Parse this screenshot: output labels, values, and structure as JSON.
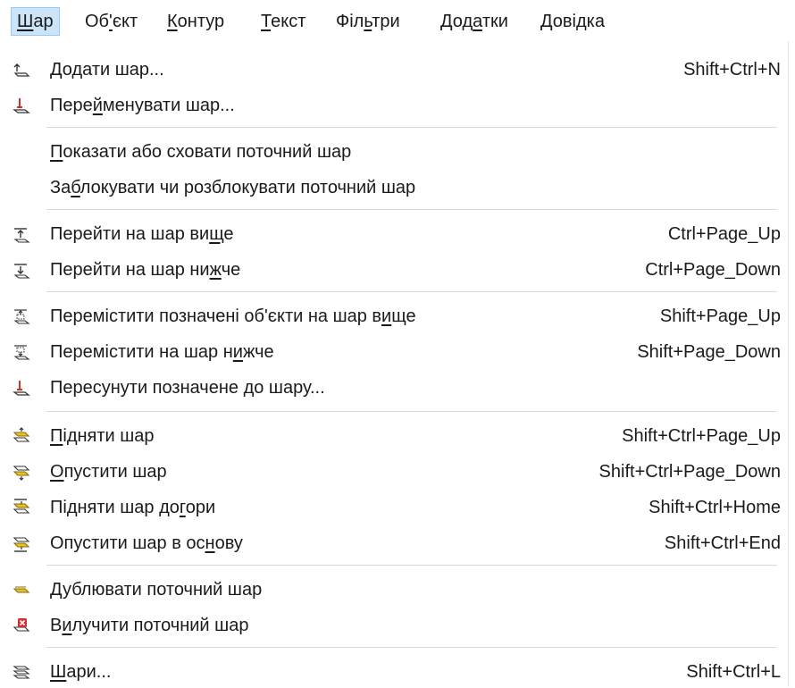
{
  "menubar": {
    "items": [
      {
        "label": "Шар",
        "accel": 0
      },
      {
        "label": "Об'єкт",
        "accel": 2
      },
      {
        "label": "Контур",
        "accel": 0
      },
      {
        "label": "Текст",
        "accel": 0
      },
      {
        "label": "Фільтри",
        "accel": 3
      },
      {
        "label": "Додатки",
        "accel": 3
      },
      {
        "label": "Довідка",
        "accel": 0
      }
    ]
  },
  "menu": {
    "items": [
      {
        "icon": "add-layer-icon",
        "label": "Додати шар...",
        "accel": 0,
        "shortcut": "Shift+Ctrl+N"
      },
      {
        "icon": "rename-layer-icon",
        "label": "Перейменувати шар...",
        "accel": 4,
        "shortcut": ""
      },
      {
        "icon": "",
        "label": "Показати або сховати поточний шар",
        "accel": 0,
        "shortcut": ""
      },
      {
        "icon": "",
        "label": "Заблокувати чи розблокувати поточний шар",
        "accel": 2,
        "shortcut": ""
      },
      {
        "icon": "layer-above-icon",
        "label": "Перейти на шар вище",
        "accel": 17,
        "shortcut": "Ctrl+Page_Up"
      },
      {
        "icon": "layer-below-icon",
        "label": "Перейти на шар нижче",
        "accel": 17,
        "shortcut": "Ctrl+Page_Down"
      },
      {
        "icon": "move-selection-up-icon",
        "label": "Перемістити позначені об'єкти на шар вище",
        "accel": 38,
        "shortcut": "Shift+Page_Up"
      },
      {
        "icon": "move-selection-down-icon",
        "label": "Перемістити на шар нижче",
        "accel": 20,
        "shortcut": "Shift+Page_Down"
      },
      {
        "icon": "move-to-layer-icon",
        "label": "Пересунути позначене до шару...",
        "accel": -1,
        "shortcut": ""
      },
      {
        "icon": "raise-layer-icon",
        "label": "Підняти шар",
        "accel": 0,
        "shortcut": "Shift+Ctrl+Page_Up"
      },
      {
        "icon": "lower-layer-icon",
        "label": "Опустити шар",
        "accel": 0,
        "shortcut": "Shift+Ctrl+Page_Down"
      },
      {
        "icon": "raise-layer-top-icon",
        "label": "Підняти шар догори",
        "accel": 14,
        "shortcut": "Shift+Ctrl+Home"
      },
      {
        "icon": "lower-layer-bottom-icon",
        "label": "Опустити шар в основу",
        "accel": 17,
        "shortcut": "Shift+Ctrl+End"
      },
      {
        "icon": "duplicate-layer-icon",
        "label": "Дублювати поточний шар",
        "accel": 0,
        "shortcut": ""
      },
      {
        "icon": "delete-layer-icon",
        "label": "Вилучити поточний шар",
        "accel": 1,
        "shortcut": ""
      },
      {
        "icon": "layers-icon",
        "label": "Шари...",
        "accel": 0,
        "shortcut": "Shift+Ctrl+L"
      }
    ]
  },
  "colors": {
    "active_menu_bg": "#cce4f7",
    "active_menu_border": "#99c9ef",
    "separator": "#d9d9d9",
    "icon_yellow": "#e6c229",
    "icon_red": "#d32f2f"
  }
}
